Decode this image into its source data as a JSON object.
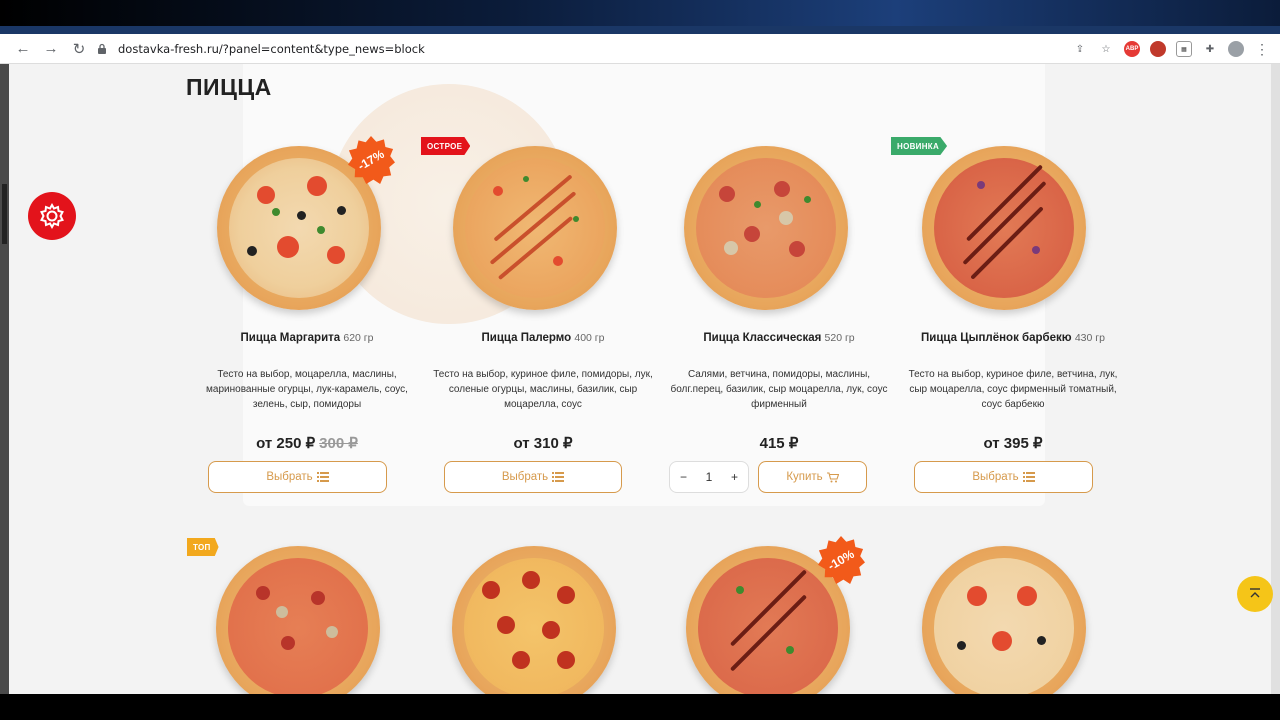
{
  "browser": {
    "url": "dostavka-fresh.ru/?panel=content&type_news=block",
    "nav": {
      "back": "←",
      "forward": "→",
      "reload": "↻"
    },
    "extensions": [
      "share-icon",
      "star-icon",
      "adblock-icon",
      "avatar-ext-icon",
      "grid-ext-icon",
      "puzzle-icon",
      "profile-icon",
      "menu-icon"
    ],
    "abp_label": "ABP"
  },
  "section": {
    "title": "ПИЦЦА"
  },
  "colors": {
    "accent": "#d69a4c",
    "red": "#e3131b",
    "badge_hot": "#e3131b",
    "badge_new": "#3aaa6a",
    "badge_top": "#f2a81d",
    "discount": "#f25a1a",
    "totop": "#f5c518"
  },
  "products": [
    {
      "name": "Пицца Маргарита",
      "weight": "620 гр",
      "desc": "Тесто на выбор, моцарелла, маслины, маринованные огурцы, лук-карамель, соус, зелень, сыр, помидоры",
      "price": "от 250 ₽",
      "old_price": "300 ₽",
      "discount": "-17%",
      "button": "Выбрать"
    },
    {
      "name": "Пицца Палермо",
      "weight": "400 гр",
      "desc": "Тесто на выбор, куриное филе, помидоры, лук, соленые огурцы, маслины, базилик, сыр моцарелла, соус",
      "price": "от 310 ₽",
      "badge": "ОСТРОЕ",
      "button": "Выбрать"
    },
    {
      "name": "Пицца Классическая",
      "weight": "520 гр",
      "desc": "Салями, ветчина, помидоры, маслины, болг.перец, базилик, сыр моцарелла, лук, соус фирменный",
      "price": "415 ₽",
      "qty": "1",
      "qty_minus": "−",
      "qty_plus": "+",
      "button": "Купить"
    },
    {
      "name": "Пицца Цыплёнок барбекю",
      "weight": "430 гр",
      "desc": "Тесто на выбор, куриное филе, ветчина, лук, сыр моцарелла, соус фирменный томатный, соус барбекю",
      "price": "от 395 ₽",
      "badge": "НОВИНКА",
      "button": "Выбрать"
    }
  ],
  "row2": [
    {
      "badge": "ТОП"
    },
    {},
    {
      "discount": "-10%"
    },
    {}
  ]
}
